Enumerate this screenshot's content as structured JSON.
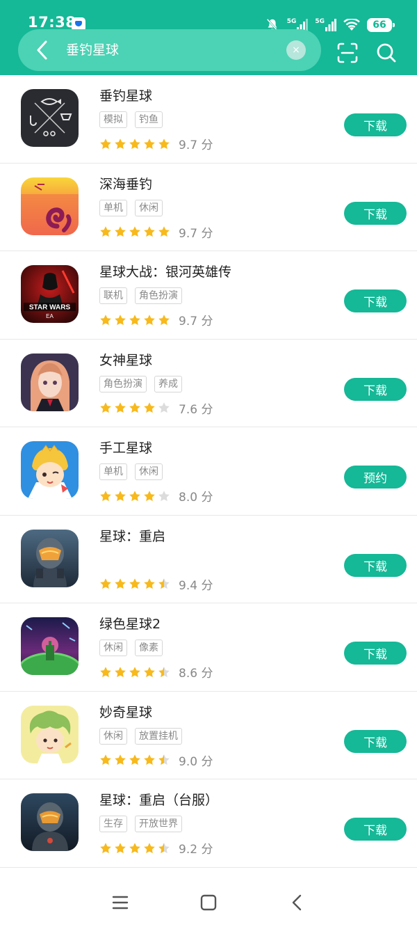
{
  "status_bar": {
    "time": "17:38",
    "battery": "66",
    "network_1": "5G",
    "network_2": "5G"
  },
  "search": {
    "query": "垂钓星球",
    "clear_symbol": "×",
    "icons": [
      "back-arrow-icon",
      "clear-icon",
      "scan-icon",
      "search-icon"
    ]
  },
  "colors": {
    "brand": "#15b897",
    "search_pill": "#4cd2b4",
    "star": "#f7b91c",
    "star_empty": "#dcdcdc"
  },
  "results": [
    {
      "name": "垂钓星球",
      "tags": [
        "模拟",
        "钓鱼"
      ],
      "stars": 5,
      "score": "9.7 分",
      "button": "下载",
      "icon": "fishing-planet-icon"
    },
    {
      "name": "深海垂钓",
      "tags": [
        "单机",
        "休闲"
      ],
      "stars": 5,
      "score": "9.7 分",
      "button": "下载",
      "icon": "deep-sea-fishing-icon"
    },
    {
      "name": "星球大战：银河英雄传",
      "tags": [
        "联机",
        "角色扮演"
      ],
      "stars": 5,
      "score": "9.7 分",
      "button": "下载",
      "icon": "star-wars-icon"
    },
    {
      "name": "女神星球",
      "tags": [
        "角色扮演",
        "养成"
      ],
      "stars": 4,
      "score": "7.6 分",
      "button": "下载",
      "icon": "goddess-planet-icon"
    },
    {
      "name": "手工星球",
      "tags": [
        "单机",
        "休闲"
      ],
      "stars": 4,
      "score": "8.0 分",
      "button": "预约",
      "icon": "craft-planet-icon"
    },
    {
      "name": "星球：重启",
      "tags": [],
      "stars": 4.5,
      "score": "9.4 分",
      "button": "下载",
      "icon": "planet-reboot-icon"
    },
    {
      "name": "绿色星球2",
      "tags": [
        "休闲",
        "像素"
      ],
      "stars": 4.5,
      "score": "8.6 分",
      "button": "下载",
      "icon": "green-planet-icon"
    },
    {
      "name": "妙奇星球",
      "tags": [
        "休闲",
        "放置挂机"
      ],
      "stars": 4.5,
      "score": "9.0 分",
      "button": "下载",
      "icon": "wonder-planet-icon"
    },
    {
      "name": "星球：重启（台服）",
      "tags": [
        "生存",
        "开放世界"
      ],
      "stars": 4.5,
      "score": "9.2 分",
      "button": "下载",
      "icon": "planet-reboot-tw-icon"
    }
  ],
  "nav": [
    "menu-icon",
    "home-icon",
    "back-icon"
  ]
}
